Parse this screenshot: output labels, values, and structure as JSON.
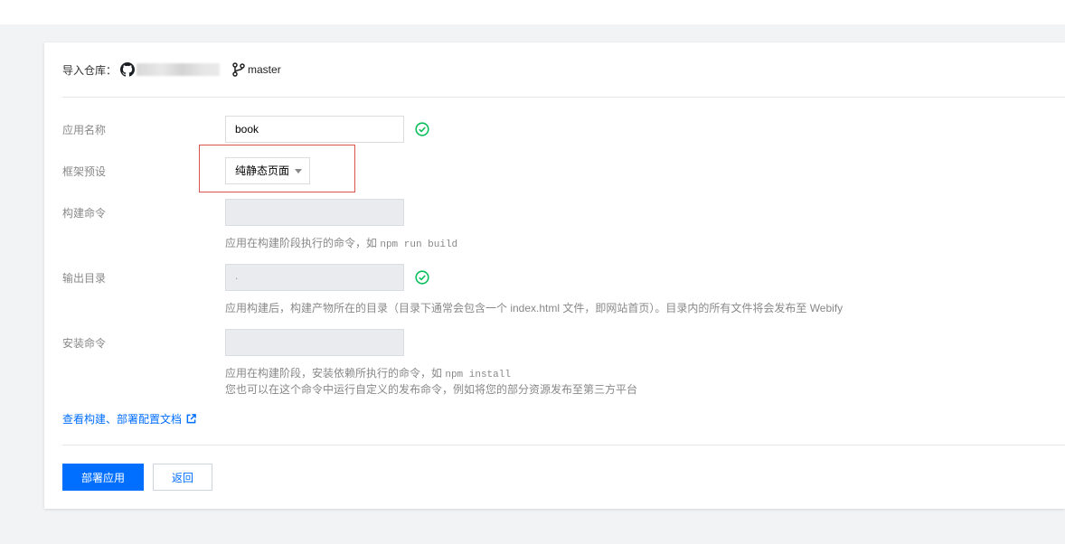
{
  "repo": {
    "label": "导入仓库：",
    "branch": "master"
  },
  "form": {
    "app_name": {
      "label": "应用名称",
      "value": "book"
    },
    "framework": {
      "label": "框架预设",
      "selected": "纯静态页面"
    },
    "build_cmd": {
      "label": "构建命令",
      "value": "",
      "help_prefix": "应用在构建阶段执行的命令，如 ",
      "help_code": "npm run build"
    },
    "output_dir": {
      "label": "输出目录",
      "value": ".",
      "help": "应用构建后，构建产物所在的目录（目录下通常会包含一个 index.html 文件，即网站首页）。目录内的所有文件将会发布至 Webify"
    },
    "install_cmd": {
      "label": "安装命令",
      "value": "",
      "help_prefix": "应用在构建阶段，安装依赖所执行的命令，如 ",
      "help_code": "npm install",
      "help2": "您也可以在这个命令中运行自定义的发布命令，例如将您的部分资源发布至第三方平台"
    }
  },
  "doc_link": "查看构建、部署配置文档",
  "buttons": {
    "deploy": "部署应用",
    "back": "返回"
  },
  "colors": {
    "primary": "#006eff",
    "success": "#0abf5b",
    "highlight": "#d9534f"
  },
  "icons": [
    "github-icon",
    "git-branch-icon",
    "check-circle-icon",
    "external-link-icon",
    "caret-down-icon"
  ]
}
